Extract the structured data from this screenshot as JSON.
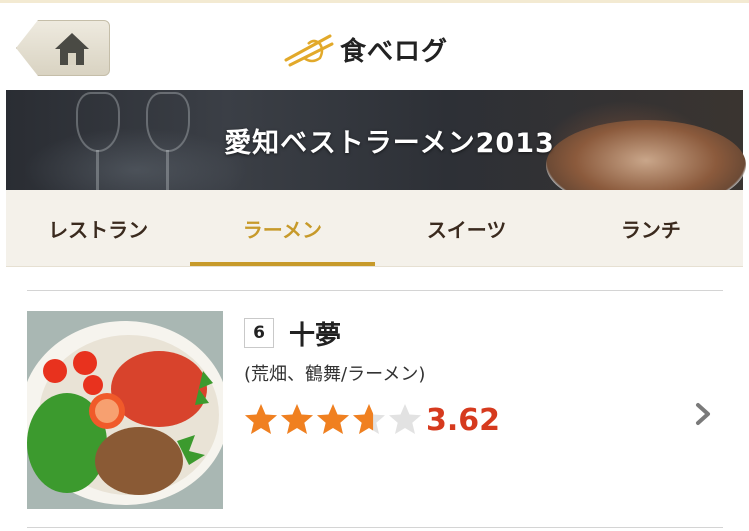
{
  "header": {
    "home_icon": "home-icon",
    "logo_text": "食べログ"
  },
  "banner": {
    "title": "愛知ベストラーメン2013"
  },
  "tabs": [
    {
      "label": "レストラン",
      "active": false
    },
    {
      "label": "ラーメン",
      "active": true
    },
    {
      "label": "スイーツ",
      "active": false
    },
    {
      "label": "ランチ",
      "active": false
    }
  ],
  "list": {
    "items": [
      {
        "rank": "6",
        "name": "十夢",
        "subtitle": "(荒畑、鶴舞/ラーメン)",
        "rating": 3.62,
        "rating_text": "3.62",
        "stars_max": 5
      }
    ]
  },
  "colors": {
    "accent": "#c79a2a",
    "star": "#f08020",
    "score": "#d63a1e"
  }
}
